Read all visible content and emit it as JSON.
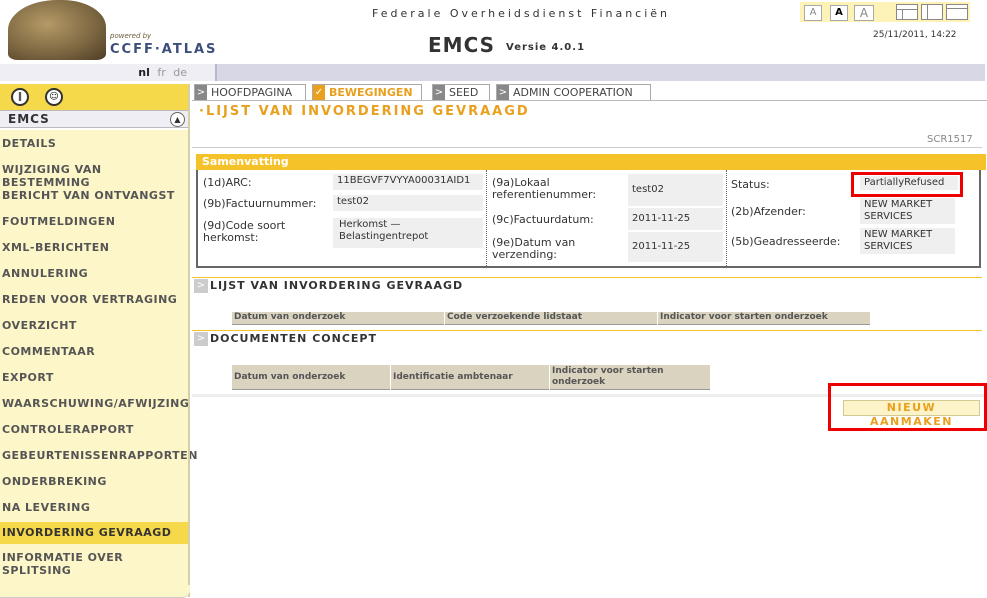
{
  "header": {
    "powered_by": "powered by",
    "brand": "CCFF·ATLAS",
    "ministry": "Federale Overheidsdienst Financiën",
    "app_name": "EMCS",
    "version": "Versie 4.0.1",
    "datetime": "25/11/2011, 14:22",
    "font_sizes": [
      "A",
      "A",
      "A"
    ]
  },
  "languages": [
    "nl",
    "fr",
    "de"
  ],
  "sidebar": {
    "title": "EMCS",
    "items": [
      "DETAILS",
      "WIJZIGING VAN BESTEMMING",
      "BERICHT VAN ONTVANGST",
      "FOUTMELDINGEN",
      "XML-BERICHTEN",
      "ANNULERING",
      "REDEN VOOR VERTRAGING",
      "OVERZICHT",
      "COMMENTAAR",
      "EXPORT",
      "WAARSCHUWING/AFWIJZING",
      "CONTROLERAPPORT",
      "GEBEURTENISSENRAPPORTEN",
      "ONDERBREKING",
      "NA LEVERING",
      "INVORDERING GEVRAAGD",
      "INFORMATIE OVER SPLITSING"
    ],
    "active_item": "INVORDERING GEVRAAGD"
  },
  "tabs": [
    "HOOFDPAGINA",
    "BEWEGINGEN",
    "SEED",
    "ADMIN COOPERATION"
  ],
  "active_tab": "BEWEGINGEN",
  "page_title": "·LIJST VAN INVORDERING GEVRAAGD",
  "screen_code": "SCR1517",
  "summary": {
    "title": "Samenvatting",
    "arc_label": "(1d)ARC:",
    "arc_value": "11BEGVF7VYYA00031AID1",
    "invoice_number_label": "(9b)Factuurnummer:",
    "invoice_number_value": "test02",
    "origin_code_label": "(9d)Code soort herkomst:",
    "origin_code_value": "Herkomst — Belastingentrepot",
    "local_ref_label": "(9a)Lokaal referentienummer:",
    "local_ref_value": "test02",
    "invoice_date_label": "(9c)Factuurdatum:",
    "invoice_date_value": "2011-11-25",
    "dispatch_date_label": "(9e)Datum van verzending:",
    "dispatch_date_value": "2011-11-25",
    "status_label": "Status:",
    "status_value": "PartiallyRefused",
    "consignor_label": "(2b)Afzender:",
    "consignor_value": "NEW MARKET SERVICES",
    "consignee_label": "(5b)Geadresseerde:",
    "consignee_value": "NEW MARKET SERVICES"
  },
  "section_recovery": {
    "title": "LIJST VAN INVORDERING GEVRAAGD",
    "columns": [
      "Datum van onderzoek",
      "Code verzoekende lidstaat",
      "Indicator voor starten onderzoek"
    ]
  },
  "section_concepts": {
    "title": "DOCUMENTEN CONCEPT",
    "columns": [
      "Datum van onderzoek",
      "Identificatie ambtenaar",
      "Indicator voor starten onderzoek"
    ]
  },
  "new_button": "NIEUW AANMAKEN",
  "colors": {
    "accent": "#e8a01e",
    "sidebar_bg": "#fdf6c8",
    "highlight": "#f6d94a",
    "annotation": "#e00000"
  }
}
